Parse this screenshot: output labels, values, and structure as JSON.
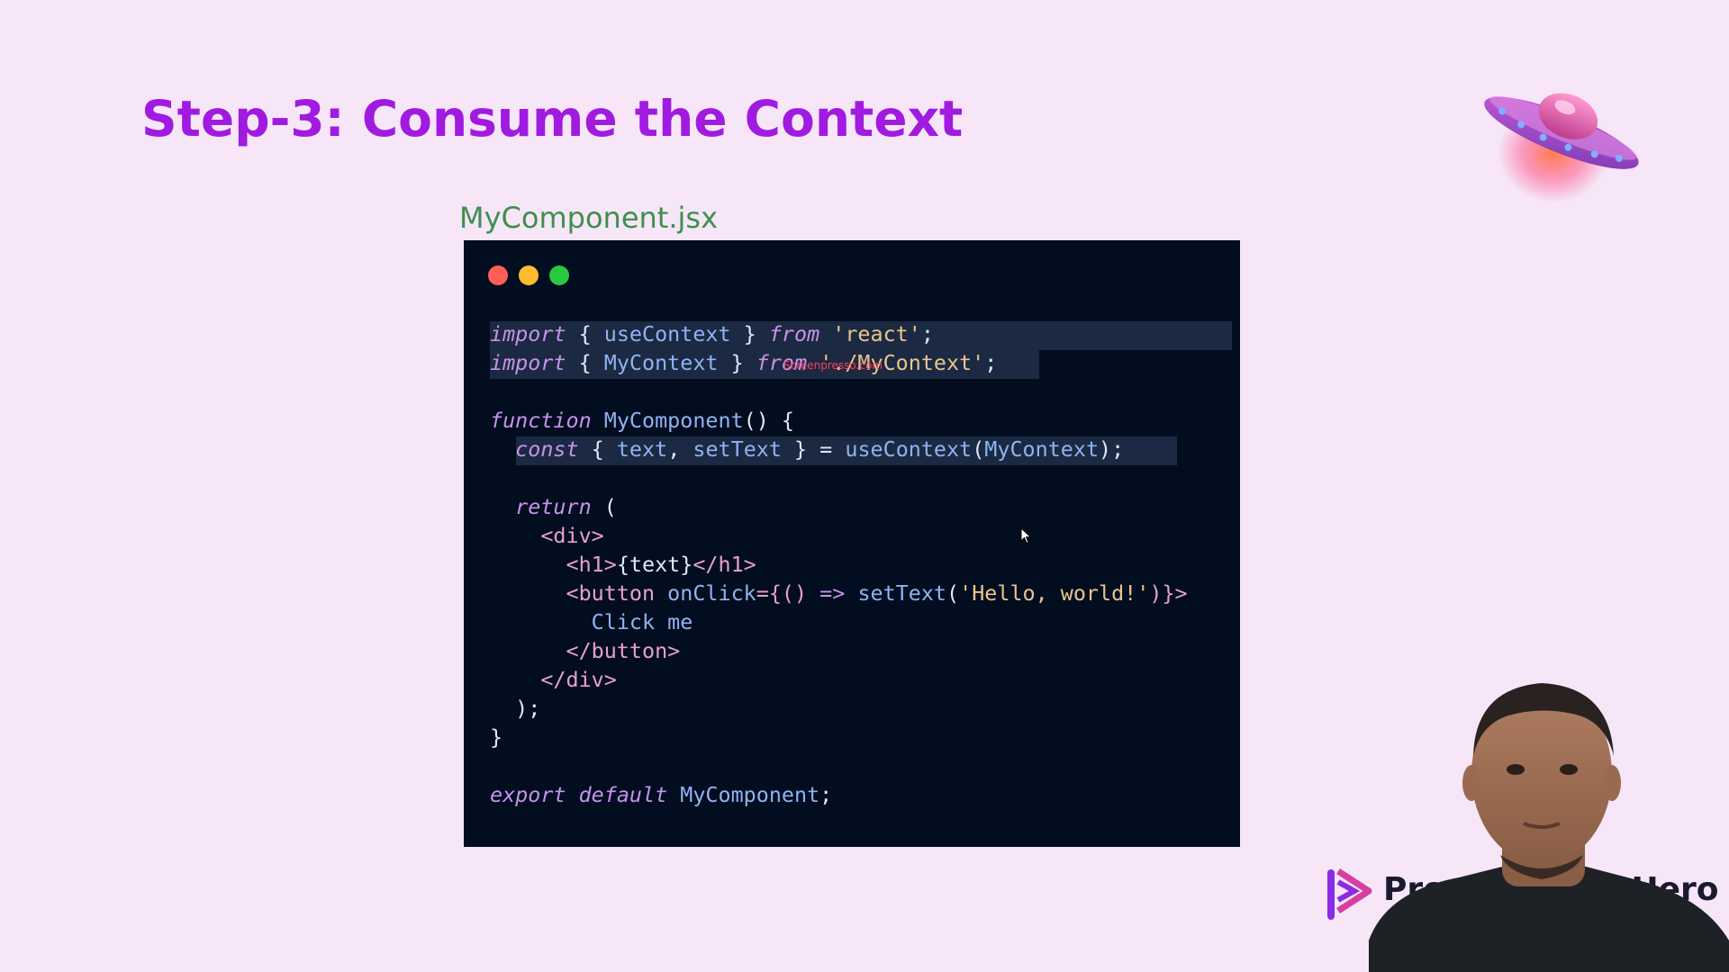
{
  "slide": {
    "title": "Step-3: Consume the Context",
    "file_name": "MyComponent.jsx"
  },
  "code_window": {
    "dots": [
      "close-dot-red",
      "minimize-dot-yellow",
      "maximize-dot-green"
    ],
    "lines": [
      [
        {
          "t": "import",
          "c": "kw"
        },
        {
          "t": " { ",
          "c": "plain"
        },
        {
          "t": "useContext",
          "c": "fn"
        },
        {
          "t": " } ",
          "c": "plain"
        },
        {
          "t": "from",
          "c": "kw"
        },
        {
          "t": " ",
          "c": "plain"
        },
        {
          "t": "'react'",
          "c": "str"
        },
        {
          "t": ";",
          "c": "plain"
        }
      ],
      [
        {
          "t": "import",
          "c": "kw"
        },
        {
          "t": " { ",
          "c": "plain"
        },
        {
          "t": "MyContext",
          "c": "fn"
        },
        {
          "t": " } ",
          "c": "plain"
        },
        {
          "t": "from",
          "c": "kw"
        },
        {
          "t": " ",
          "c": "plain"
        },
        {
          "t": "'./MyContext'",
          "c": "str"
        },
        {
          "t": ";",
          "c": "plain"
        }
      ],
      [],
      [
        {
          "t": "function",
          "c": "kw"
        },
        {
          "t": " ",
          "c": "plain"
        },
        {
          "t": "MyComponent",
          "c": "fn"
        },
        {
          "t": "() {",
          "c": "plain"
        }
      ],
      [
        {
          "t": "  ",
          "c": "plain"
        },
        {
          "t": "const",
          "c": "kw"
        },
        {
          "t": " { ",
          "c": "plain"
        },
        {
          "t": "text",
          "c": "fn"
        },
        {
          "t": ", ",
          "c": "plain"
        },
        {
          "t": "setText",
          "c": "fn"
        },
        {
          "t": " } = ",
          "c": "plain"
        },
        {
          "t": "useContext",
          "c": "fn"
        },
        {
          "t": "(",
          "c": "plain"
        },
        {
          "t": "MyContext",
          "c": "fn"
        },
        {
          "t": ");",
          "c": "plain"
        }
      ],
      [],
      [
        {
          "t": "  ",
          "c": "plain"
        },
        {
          "t": "return",
          "c": "kw"
        },
        {
          "t": " (",
          "c": "plain"
        }
      ],
      [
        {
          "t": "    ",
          "c": "plain"
        },
        {
          "t": "<div>",
          "c": "tag"
        }
      ],
      [
        {
          "t": "      ",
          "c": "plain"
        },
        {
          "t": "<h1>",
          "c": "tag"
        },
        {
          "t": "{text}",
          "c": "plain"
        },
        {
          "t": "</h1>",
          "c": "tag"
        }
      ],
      [
        {
          "t": "      ",
          "c": "plain"
        },
        {
          "t": "<button ",
          "c": "tag"
        },
        {
          "t": "onClick",
          "c": "fn"
        },
        {
          "t": "={() ",
          "c": "tag"
        },
        {
          "t": "=>",
          "c": "kw"
        },
        {
          "t": " ",
          "c": "plain"
        },
        {
          "t": "setText",
          "c": "fn"
        },
        {
          "t": "(",
          "c": "plain"
        },
        {
          "t": "'Hello, world!'",
          "c": "str"
        },
        {
          "t": ")}>",
          "c": "tag"
        }
      ],
      [
        {
          "t": "        ",
          "c": "plain"
        },
        {
          "t": "Click me",
          "c": "fn"
        }
      ],
      [
        {
          "t": "      ",
          "c": "plain"
        },
        {
          "t": "</button>",
          "c": "tag"
        }
      ],
      [
        {
          "t": "    ",
          "c": "plain"
        },
        {
          "t": "</div>",
          "c": "tag"
        }
      ],
      [
        {
          "t": "  );",
          "c": "plain"
        }
      ],
      [
        {
          "t": "}",
          "c": "plain"
        }
      ],
      [],
      [
        {
          "t": "export",
          "c": "kw"
        },
        {
          "t": " ",
          "c": "plain"
        },
        {
          "t": "default",
          "c": "kw"
        },
        {
          "t": " ",
          "c": "plain"
        },
        {
          "t": "MyComponent",
          "c": "fn"
        },
        {
          "t": ";",
          "c": "plain"
        }
      ]
    ],
    "watermark": "Screenpresso.com"
  },
  "brand": {
    "text": "ProgrammingHero",
    "icon": "play-logo-icon"
  },
  "colors": {
    "title": "#a01ae0",
    "file_name": "#3f8f4e",
    "code_bg": "#020d1f",
    "slide_bg": "#f6e6f8"
  }
}
